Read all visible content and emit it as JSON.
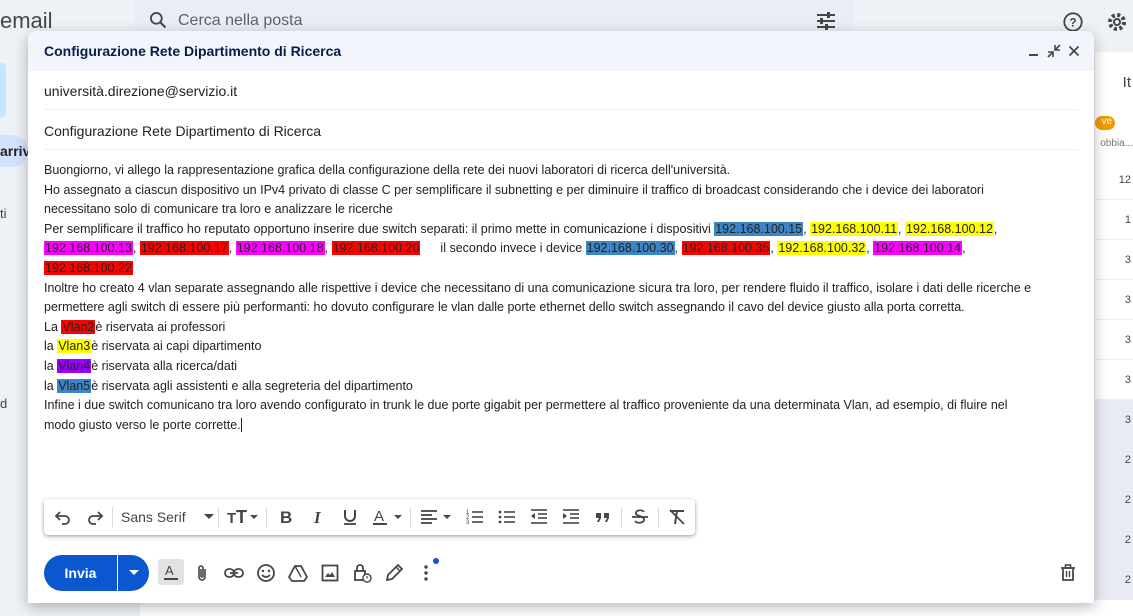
{
  "background": {
    "logo_text": "email",
    "search_placeholder": "Cerca nella posta",
    "left_item_label": "arrivi",
    "left_letters": [
      "ti",
      "d"
    ],
    "right_header": "It",
    "right_badge": "ve",
    "right_sub": "obbia...",
    "right_counts": [
      "12",
      "1",
      "3",
      "3",
      "3",
      "3",
      "3",
      "2",
      "2",
      "2",
      "2"
    ]
  },
  "compose": {
    "title": "Configurazione Rete Dipartimento di Ricerca",
    "recipient": "università.direzione@servizio.it",
    "subject": "Configurazione Rete Dipartimento di Ricerca",
    "body": {
      "l1": "Buongiorno, vi allego la rappresentazione grafica della configurazione della rete dei nuovi laboratori di ricerca dell'università.",
      "l2": "Ho assegnato a ciascun dispositivo un IPv4 privato di classe C per semplificare il subnetting e per diminuire il traffico di broadcast considerando che i device dei laboratori",
      "l3": "necessitano solo di comunicare tra loro e analizzare le ricerche",
      "l4_pre": "Per semplificare il traffico ho reputato opportuno inserire due switch separati: il primo mette in comunicazione i dispositivi ",
      "ip1": "192.168.100.15",
      "ip2": "192.168.100.11",
      "ip3": "192.168.100.12",
      "ip4": "192.168.100.13",
      "ip5": "192.168.100.17",
      "ip6": "192.168.100.18",
      "ip7": "192.168.100.20",
      "second_switch": "il secondo invece i device ",
      "ip8": "192.168.100.30",
      "ip9": "192.168.100.35",
      "ip10": "192.168.100.32",
      "ip11": "192.168.100.14",
      "ip12": "192.168.100.22",
      "comma": ", ",
      "l7": " Inoltre ho creato 4 vlan separate assegnando alle rispettive i device che necessitano di una comunicazione sicura tra loro, per rendere fluido il traffico, isolare i dati delle ricerche e",
      "l8": "permettere agli switch di essere più performanti: ho dovuto configurare le vlan dalle porte ethernet dello switch assegnando il cavo del device giusto alla porta corretta.",
      "vlan_lines": [
        {
          "prefix": "La ",
          "vlan": "Vlan2",
          "text": "è riservata ai professori"
        },
        {
          "prefix": "la ",
          "vlan": "Vlan3",
          "text": "è riservata ai capi dipartimento"
        },
        {
          "prefix": "la ",
          "vlan": "Vlan4",
          "text": "è riservata alla ricerca/dati"
        },
        {
          "prefix": "la ",
          "vlan": "Vlan5",
          "text": "è riservata agli assistenti e alla segreteria del dipartimento"
        }
      ],
      "l13": "Infine i due switch comunicano tra loro avendo configurato in trunk le due porte gigabit per permettere al traffico proveniente da una determinata Vlan, ad esempio, di fluire nel",
      "l14": "modo giusto verso le porte corrette."
    },
    "toolbar": {
      "font": "Sans Serif"
    },
    "send_label": "Invia"
  },
  "colors": {
    "accent": "#0b57d0",
    "highlight_blue": "#3d85c6",
    "highlight_yellow": "#ffff00",
    "highlight_magenta": "#ff00ff",
    "highlight_red": "#ff0000",
    "highlight_purple": "#9900ff"
  }
}
